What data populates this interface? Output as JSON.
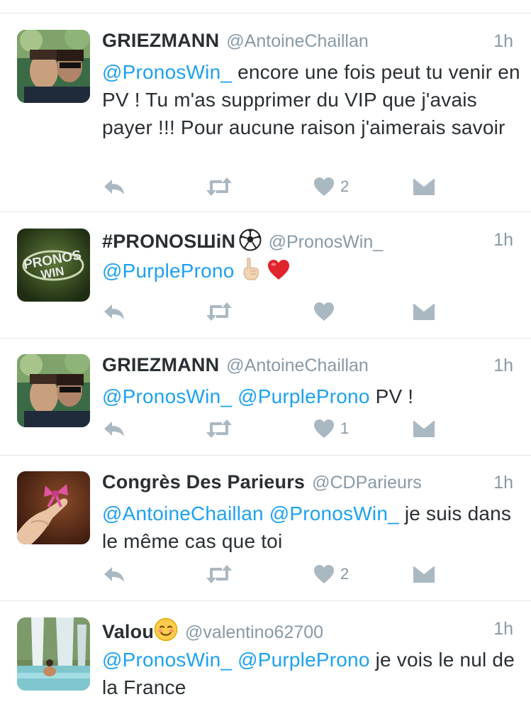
{
  "tweets": [
    {
      "name": "GRIEZMANN",
      "handle": "@AntoineChaillan",
      "time": "1h",
      "avatar": "selfie-photo",
      "body": [
        {
          "type": "mention",
          "text": "@PronosWin_"
        },
        {
          "type": "text",
          "text": " encore une fois peut tu venir en PV ! Tu m'as supprimer du VIP que j'avais payer !!! Pour aucune raison j'aimerais savoir"
        }
      ],
      "like_count": "2"
    },
    {
      "name": "#PRONOSШiN",
      "name_emoji": "soccer-ball-icon",
      "handle": "@PronosWin_",
      "time": "1h",
      "avatar": "pronos-win-logo",
      "body": [
        {
          "type": "mention",
          "text": "@PurpleProno"
        }
      ],
      "body_emojis": [
        "pointing-up-icon",
        "red-heart-icon"
      ],
      "like_count": ""
    },
    {
      "name": "GRIEZMANN",
      "handle": "@AntoineChaillan",
      "time": "1h",
      "avatar": "selfie-photo",
      "body": [
        {
          "type": "mention",
          "text": "@PronosWin_ @PurpleProno"
        },
        {
          "type": "text",
          "text": " PV !"
        }
      ],
      "like_count": "1"
    },
    {
      "name": "Congrès Des Parieurs",
      "handle": "@CDParieurs",
      "time": "1h",
      "avatar": "ribbon-finger-photo",
      "body": [
        {
          "type": "mention",
          "text": "@AntoineChaillan @PronosWin_"
        },
        {
          "type": "text",
          "text": " je suis dans le même cas que toi"
        }
      ],
      "like_count": "2"
    },
    {
      "name": "Valou",
      "name_emoji": "smiling-face-icon",
      "handle": "@valentino62700",
      "time": "1h",
      "avatar": "waterfall-photo",
      "body": [
        {
          "type": "mention",
          "text": "@PronosWin_ @PurpleProno"
        },
        {
          "type": "text",
          "text": " je vois le nul de la France"
        }
      ],
      "like_count": ""
    }
  ],
  "colors": {
    "mention": "#1da1f2",
    "muted": "#8899a6",
    "icon": "#aab8c2",
    "text": "#292f33",
    "divider": "#e1e8ed"
  }
}
